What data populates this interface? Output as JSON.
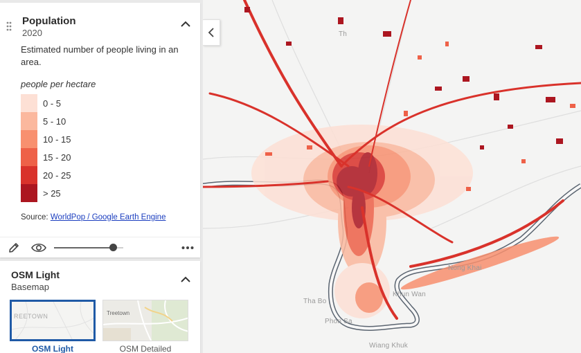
{
  "layer": {
    "title": "Population",
    "year": "2020",
    "description": "Estimated number of people living in an area.",
    "legend_title": "people per hectare",
    "legend": [
      {
        "label": "0 - 5",
        "color": "#fde0d5"
      },
      {
        "label": "5 - 10",
        "color": "#fbb89e"
      },
      {
        "label": "10 - 15",
        "color": "#f8906f"
      },
      {
        "label": "15 - 20",
        "color": "#ee6148"
      },
      {
        "label": "20 - 25",
        "color": "#d9322b"
      },
      {
        "label": "> 25",
        "color": "#ac1620"
      }
    ],
    "source_prefix": "Source: ",
    "source_link": "WorldPop / Google Earth Engine",
    "opacity": 0.85
  },
  "basemap": {
    "title": "OSM Light",
    "subtitle": "Basemap",
    "options": [
      {
        "label": "OSM Light",
        "thumb_text": "REETOWN",
        "selected": true
      },
      {
        "label": "OSM Detailed",
        "thumb_text": "Treetown",
        "selected": false
      }
    ]
  },
  "map": {
    "labels": [
      "Nong Khai",
      "Khun Wan",
      "Tha Bo",
      "Phon Sa",
      "Wiang Khuk",
      "Th"
    ],
    "colors": {
      "river_outline": "#5a6470",
      "water": "#f7f7f7",
      "land": "#f4f4f3"
    }
  },
  "icons": {
    "drag": "drag-handle-icon",
    "collapse": "chevron-up-icon",
    "edit": "pencil-icon",
    "visibility": "eye-icon",
    "more": "more-horizontal-icon",
    "panel_toggle": "chevron-left-icon"
  }
}
